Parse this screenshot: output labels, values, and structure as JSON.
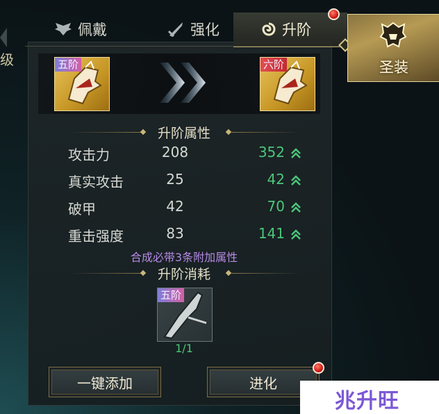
{
  "left_stub": {
    "text": "级"
  },
  "tabs": [
    {
      "label": "佩戴",
      "icon": "wings-icon"
    },
    {
      "label": "强化",
      "icon": "sword-icon"
    },
    {
      "label": "升阶",
      "icon": "swirl-icon",
      "active": true
    }
  ],
  "side_card": {
    "label": "圣装",
    "icon": "helmet-icon"
  },
  "upgrade": {
    "from_tier": "五阶",
    "to_tier": "六阶"
  },
  "attributes_title": "升阶属性",
  "stats": [
    {
      "name": "攻击力",
      "old": "208",
      "new": "352"
    },
    {
      "name": "真实攻击",
      "old": "25",
      "new": "42"
    },
    {
      "name": "破甲",
      "old": "42",
      "new": "70"
    },
    {
      "name": "重击强度",
      "old": "83",
      "new": "141"
    }
  ],
  "note": "合成必带3条附加属性",
  "cost_title": "升阶消耗",
  "cost_item": {
    "tier": "五阶",
    "count": "1/1"
  },
  "buttons": {
    "auto_add": "一键添加",
    "evolve": "进化"
  },
  "watermark": "兆升旺",
  "colors": {
    "increase_green": "#4cc67a",
    "note_purple": "#b68ae6",
    "gold": "#c9b57a"
  }
}
